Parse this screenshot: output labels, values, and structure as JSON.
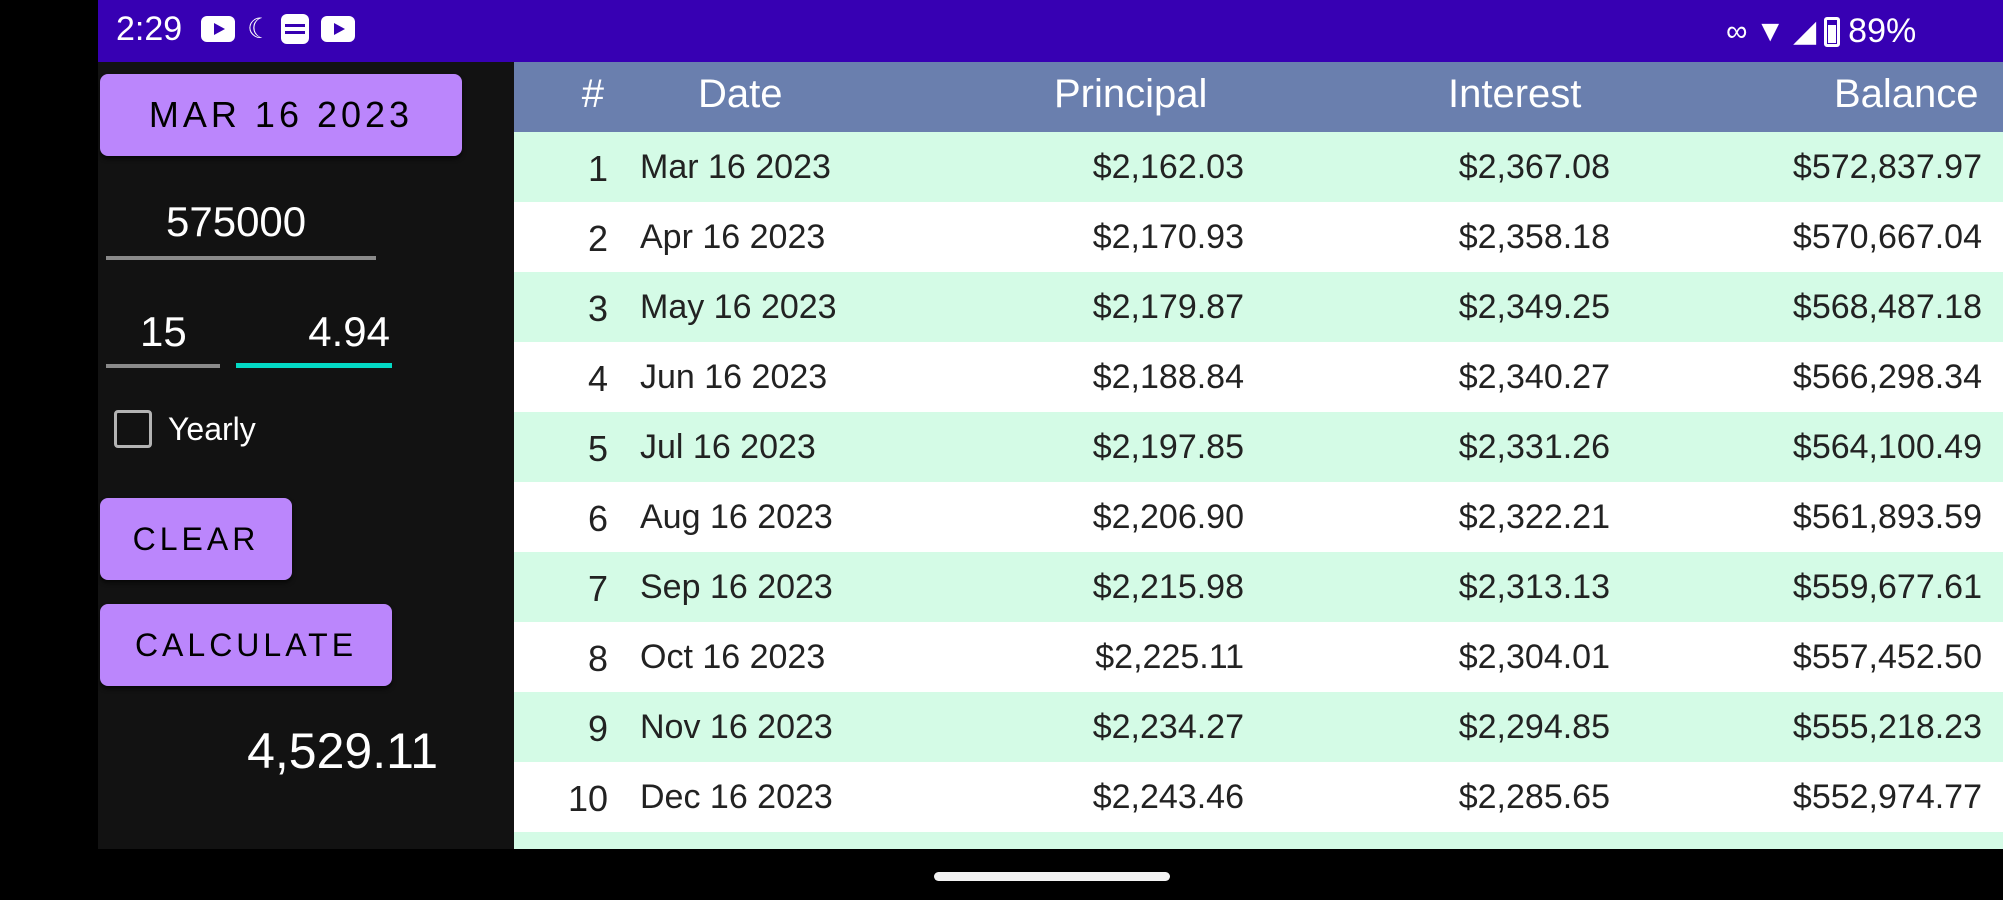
{
  "status_bar": {
    "time": "2:29",
    "battery_percent": "89%",
    "icons": [
      "youtube-icon",
      "moon-icon",
      "database-icon",
      "youtube-icon",
      "voicemail-icon",
      "wifi-icon",
      "signal-icon",
      "battery-icon"
    ]
  },
  "inputs": {
    "date_button": "MAR 16 2023",
    "principal": "575000",
    "term": "15",
    "rate": "4.94",
    "yearly_label": "Yearly",
    "yearly_checked": false
  },
  "buttons": {
    "clear": "CLEAR",
    "calculate": "CALCULATE"
  },
  "result": {
    "payment": "4,529.11"
  },
  "table": {
    "headers": [
      "#",
      "Date",
      "Principal",
      "Interest",
      "Balance"
    ],
    "rows": [
      {
        "num": "1",
        "date": "Mar 16 2023",
        "principal": "$2,162.03",
        "interest": "$2,367.08",
        "balance": "$572,837.97"
      },
      {
        "num": "2",
        "date": "Apr 16 2023",
        "principal": "$2,170.93",
        "interest": "$2,358.18",
        "balance": "$570,667.04"
      },
      {
        "num": "3",
        "date": "May 16 2023",
        "principal": "$2,179.87",
        "interest": "$2,349.25",
        "balance": "$568,487.18"
      },
      {
        "num": "4",
        "date": "Jun 16 2023",
        "principal": "$2,188.84",
        "interest": "$2,340.27",
        "balance": "$566,298.34"
      },
      {
        "num": "5",
        "date": "Jul 16 2023",
        "principal": "$2,197.85",
        "interest": "$2,331.26",
        "balance": "$564,100.49"
      },
      {
        "num": "6",
        "date": "Aug 16 2023",
        "principal": "$2,206.90",
        "interest": "$2,322.21",
        "balance": "$561,893.59"
      },
      {
        "num": "7",
        "date": "Sep 16 2023",
        "principal": "$2,215.98",
        "interest": "$2,313.13",
        "balance": "$559,677.61"
      },
      {
        "num": "8",
        "date": "Oct 16 2023",
        "principal": "$2,225.11",
        "interest": "$2,304.01",
        "balance": "$557,452.50"
      },
      {
        "num": "9",
        "date": "Nov 16 2023",
        "principal": "$2,234.27",
        "interest": "$2,294.85",
        "balance": "$555,218.23"
      },
      {
        "num": "10",
        "date": "Dec 16 2023",
        "principal": "$2,243.46",
        "interest": "$2,285.65",
        "balance": "$552,974.77"
      }
    ]
  },
  "colors": {
    "status_bar": "#3700b3",
    "button": "#bb86fc",
    "accent": "#03dac5",
    "header": "#6a7fae",
    "row_alt": "#d4fbe6"
  }
}
